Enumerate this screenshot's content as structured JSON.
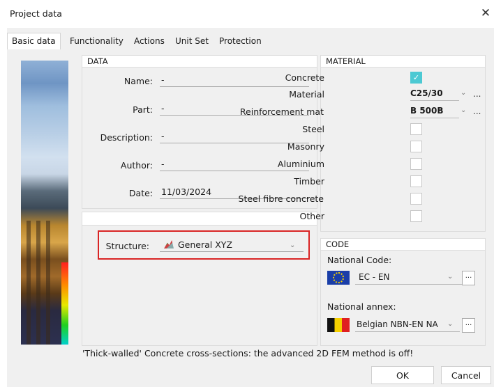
{
  "window": {
    "title": "Project data",
    "close_glyph": "✕"
  },
  "tabs": [
    "Basic data",
    "Functionality",
    "Actions",
    "Unit Set",
    "Protection"
  ],
  "data_panel": {
    "header": "DATA",
    "fields": [
      {
        "label": "Name:",
        "value": "-"
      },
      {
        "label": "Part:",
        "value": "-"
      },
      {
        "label": "Description:",
        "value": "-"
      },
      {
        "label": "Author:",
        "value": "-"
      },
      {
        "label": "Date:",
        "value": "11/03/2024"
      }
    ]
  },
  "structure": {
    "label": "Structure:",
    "value": "General XYZ",
    "icon": "structure-icon"
  },
  "material_panel": {
    "header": "MATERIAL",
    "concrete_label": "Concrete",
    "concrete_checked": true,
    "material_label": "Material",
    "material_value": "C25/30",
    "reinforcement_label": "Reinforcement mat",
    "reinforcement_value": "B 500B",
    "others": [
      "Steel",
      "Masonry",
      "Aluminium",
      "Timber",
      "Steel fibre concrete",
      "Other"
    ],
    "accent": "#4cc9d3"
  },
  "code_panel": {
    "header": "CODE",
    "national_code_label": "National Code:",
    "national_code_value": "EC - EN",
    "national_annex_label": "National annex:",
    "national_annex_value": "Belgian NBN-EN NA"
  },
  "status_message": "'Thick-walled' Concrete cross-sections: the advanced 2D FEM method is off!",
  "buttons": {
    "ok": "OK",
    "cancel": "Cancel"
  },
  "colors": {
    "highlight_border": "#d92424"
  }
}
